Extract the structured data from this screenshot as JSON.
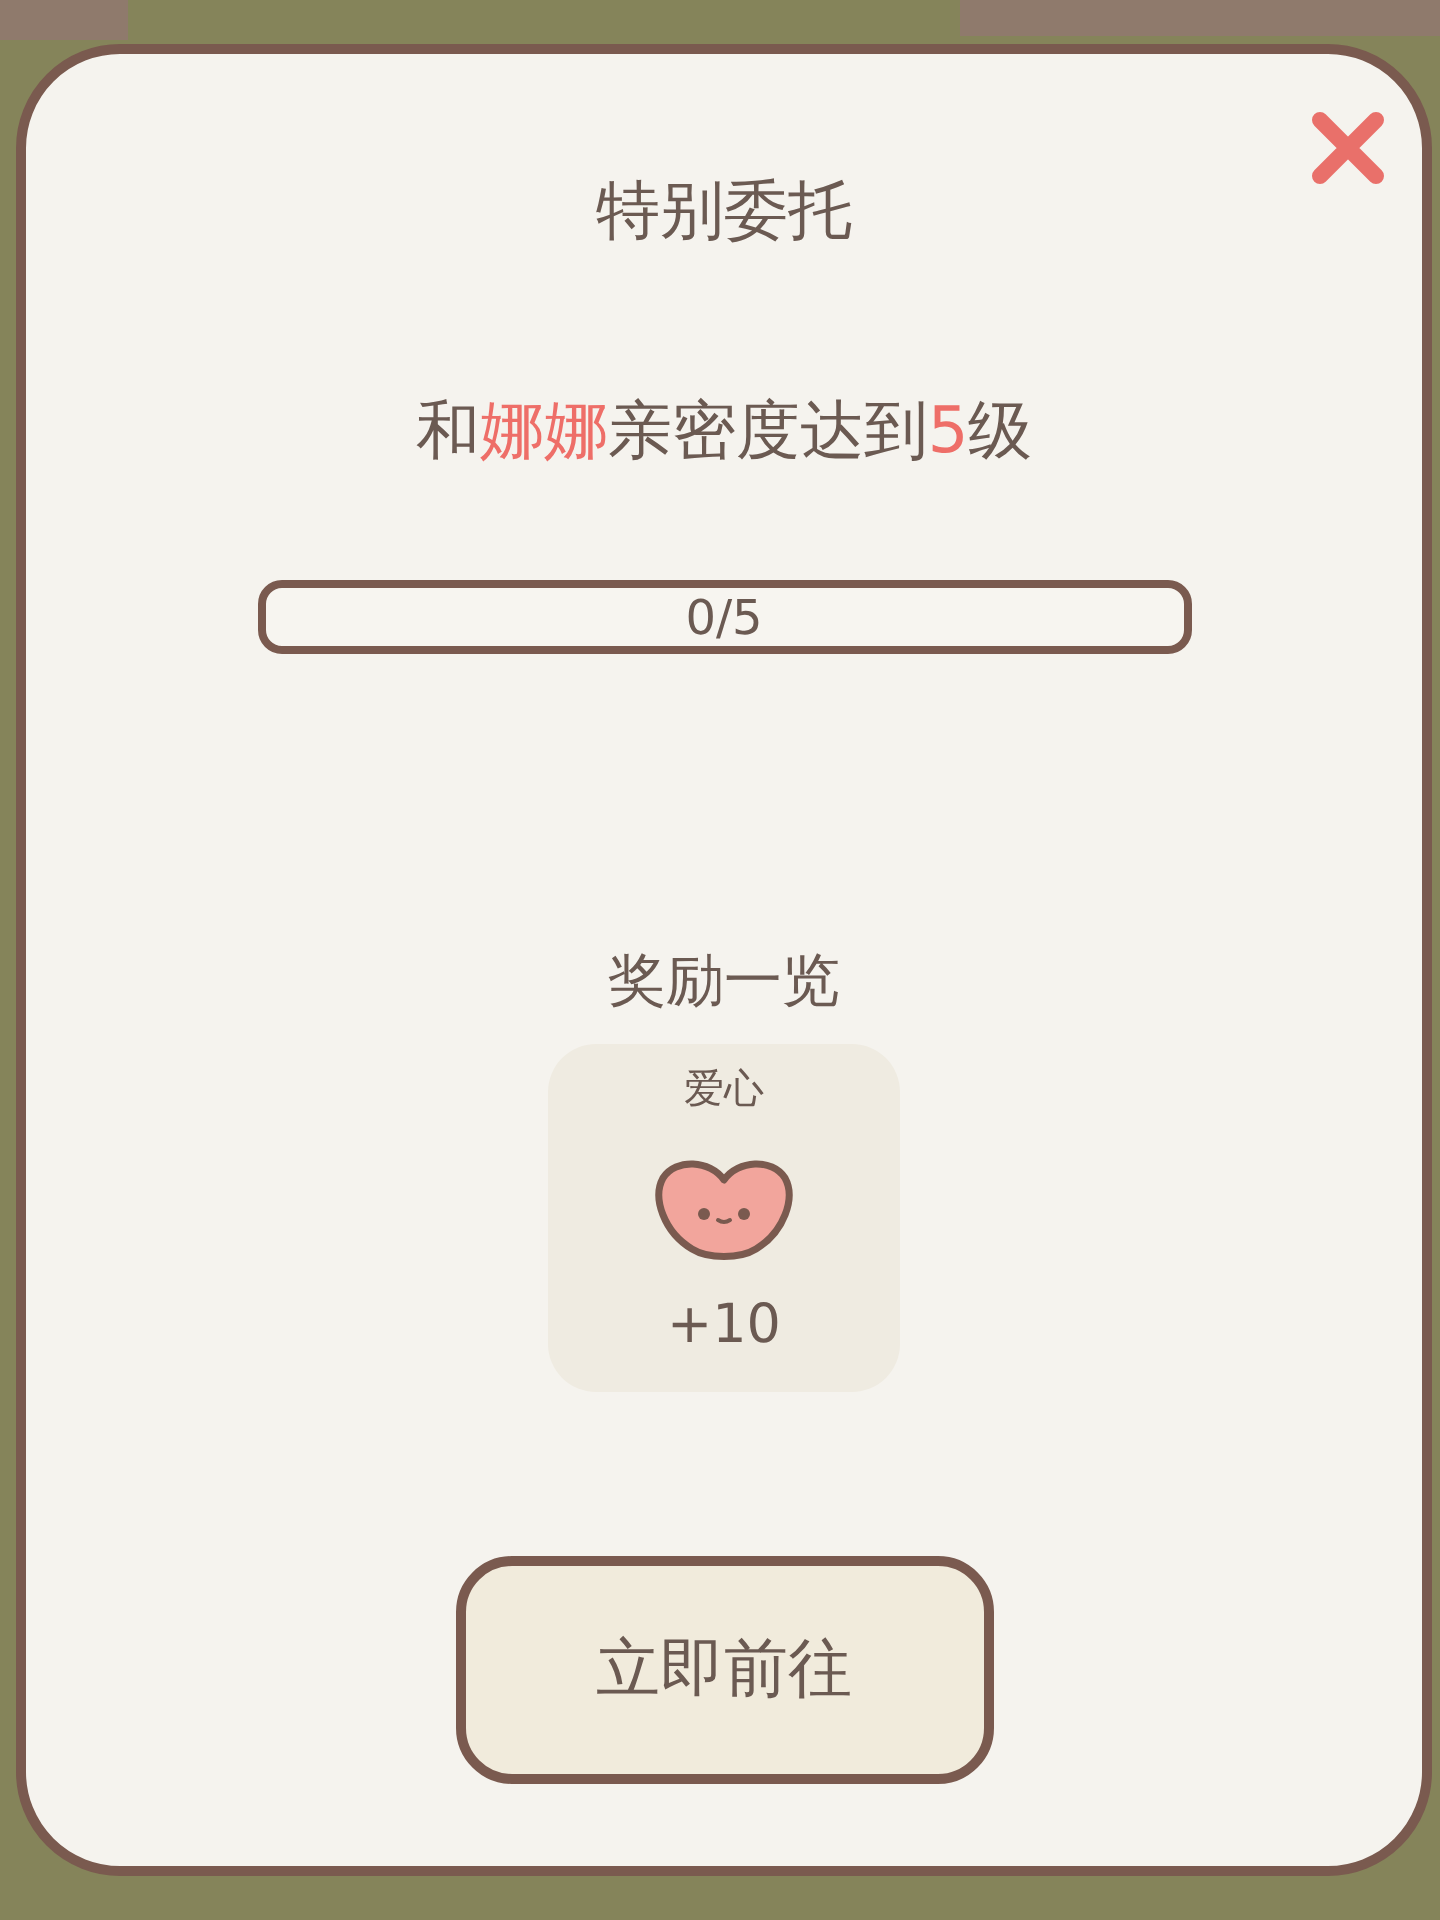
{
  "dialog": {
    "title": "特别委托",
    "task": {
      "segments": [
        {
          "text": "和",
          "highlight": false
        },
        {
          "text": "娜娜",
          "highlight": true
        },
        {
          "text": "亲密度达到",
          "highlight": false
        },
        {
          "text": "5",
          "highlight": true
        },
        {
          "text": "级",
          "highlight": false
        }
      ]
    },
    "progress": {
      "level": 0,
      "reading": "0/5"
    },
    "rewards": {
      "heading": "奖励一览",
      "items": [
        {
          "name": "爱心",
          "amount": "+10"
        }
      ]
    },
    "button": "立即前往"
  }
}
